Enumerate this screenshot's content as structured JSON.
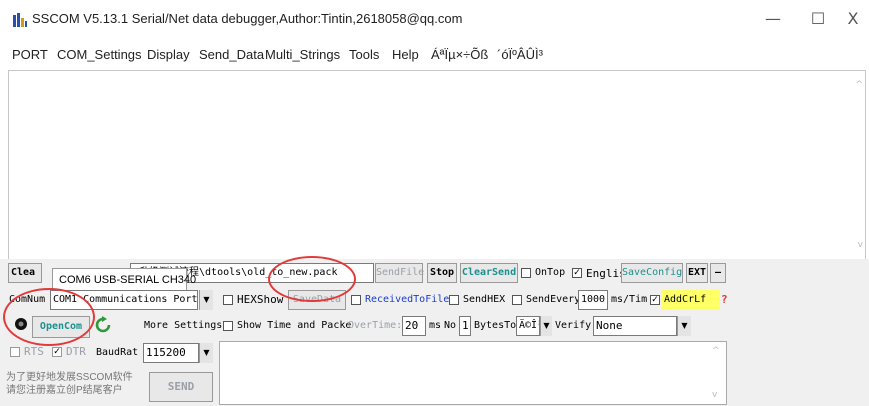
{
  "window": {
    "title": "SSCOM V5.13.1 Serial/Net data debugger,Author:Tintin,2618058@qq.com",
    "minimize_glyph": "—",
    "maximize_glyph": "☐",
    "close_glyph": "X"
  },
  "menu": [
    "PORT",
    "COM_Settings",
    "Display",
    "Send_Data",
    "Multi_Strings",
    "Tools",
    "Help",
    "ÁªÏµ×÷Õß",
    "´óÏºÂÛÌ³"
  ],
  "receive": {
    "text": ""
  },
  "row1": {
    "clear_label": "Clea",
    "port_tooltip": "COM6 USB-SERIAL CH340",
    "file_path": "\\升级测试流程\\dtools\\old_to_new.pack",
    "sendfile_label": "SendFile",
    "stop_label": "Stop",
    "clearsend_label": "ClearSend",
    "ontop_label": "OnTop",
    "ontop_checked": false,
    "english_label": "English",
    "english_checked": true,
    "saveconfig_label": "SaveConfig",
    "ext_label": "EXT",
    "collapse_label": "—"
  },
  "row2": {
    "comnum_label": "ComNum",
    "port_value": "COM1 Communications Port",
    "hexshow_label": "HEXShow",
    "hexshow_checked": false,
    "savedata_label": "SaveData",
    "receivedtofile_label": "ReceivedToFile",
    "receivedtofile_checked": false,
    "sendhex_label": "SendHEX",
    "sendhex_checked": false,
    "sendevery_label": "SendEvery:",
    "sendevery_value": "1000",
    "ms_tim_label": "ms/Tim",
    "addcrlf_checked": true,
    "addcrlf_label": "AddCrLf",
    "help_glyph": "?"
  },
  "row3": {
    "open_label": "OpenCom",
    "more_settings_label": "More Settings",
    "showtime_label": "Show Time and Packe",
    "showtime_checked": false,
    "overtime_label": "OverTime:",
    "overtime_value": "20",
    "ms_label": "ms",
    "no_label": "No",
    "no_value": "1",
    "bytesto_label": "BytesTo",
    "bytesto_value": "Ä©Î²",
    "verify_label": "Verify",
    "verify_value": "None"
  },
  "row4": {
    "rts_label": "RTS",
    "rts_checked": false,
    "dtr_label": "DTR",
    "dtr_checked": true,
    "baud_label": "BaudRat",
    "baud_value": "115200"
  },
  "footer": {
    "promo_line1": "为了更好地发展SSCOM软件",
    "promo_line2": "请您注册嘉立创P结尾客户",
    "send_label": "SEND"
  },
  "colors": {
    "accent_teal": "#1d8f8f",
    "annotation_red": "#e23a3a",
    "addcrlf_bg": "#ffff66"
  }
}
